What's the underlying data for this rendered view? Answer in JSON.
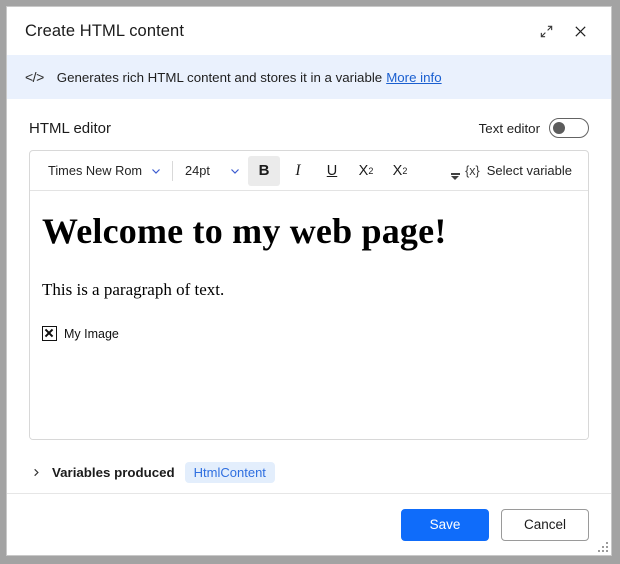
{
  "window": {
    "title": "Create HTML content",
    "expand_icon": "expand-diagonal-icon",
    "close_icon": "close-icon"
  },
  "banner": {
    "icon": "</>",
    "text": "Generates rich HTML content and stores it in a variable",
    "link": "More info"
  },
  "editor": {
    "label": "HTML editor",
    "toggle_label": "Text editor",
    "toggle_state": "off"
  },
  "toolbar": {
    "font_family": "Times New Rom",
    "font_size": "24pt",
    "bold": "B",
    "italic": "I",
    "underline": "U",
    "subscript_base": "X",
    "subscript_mark": "2",
    "superscript_base": "X",
    "superscript_mark": "2",
    "overflow": "more-options",
    "select_variable_icon": "{x}",
    "select_variable_label": "Select variable"
  },
  "document": {
    "heading": "Welcome to my web page!",
    "paragraph": "This is a paragraph of text.",
    "image_alt": "My Image"
  },
  "variables": {
    "chevron": "chevron-right-icon",
    "label": "Variables produced",
    "badge": "HtmlContent"
  },
  "footer": {
    "save_label": "Save",
    "cancel_label": "Cancel"
  },
  "colors": {
    "primary": "#0f6cfa",
    "banner_bg": "#eaf1fd",
    "link": "#1a5fd0",
    "badge_bg": "#e3eefc",
    "badge_text": "#2f6fe0"
  }
}
